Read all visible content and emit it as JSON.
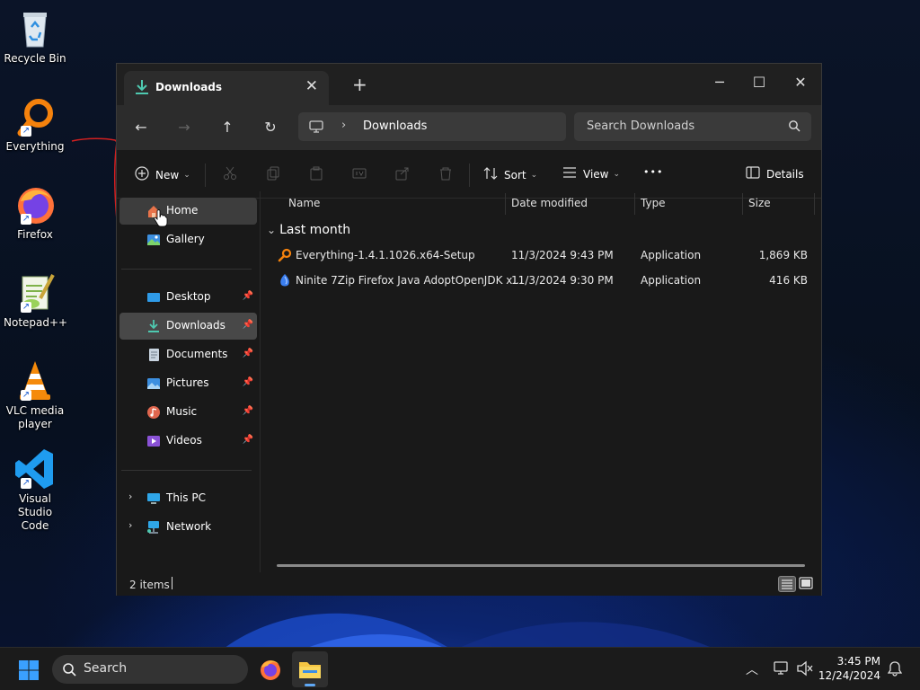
{
  "desktop": {
    "icons": [
      {
        "label": "Recycle Bin",
        "icon": "recycle-bin-icon"
      },
      {
        "label": "Everything",
        "icon": "everything-search-icon"
      },
      {
        "label": "Firefox",
        "icon": "firefox-icon"
      },
      {
        "label": "Notepad++",
        "icon": "notepad-plus-plus-icon"
      },
      {
        "label": "VLC media player",
        "icon": "vlc-icon"
      },
      {
        "label": "Visual Studio Code",
        "icon": "vscode-icon"
      }
    ]
  },
  "window": {
    "tab_title": "Downloads",
    "tab_close": "✕",
    "new_tab": "+",
    "controls": {
      "minimize": "─",
      "maximize": "☐",
      "close": "✕"
    },
    "nav": {
      "back": "←",
      "forward": "→",
      "up": "↑",
      "refresh": "↻"
    },
    "address": {
      "separator": "›",
      "crumb": "Downloads"
    },
    "search_placeholder": "Search Downloads",
    "commands": {
      "new": "New",
      "sort": "Sort",
      "view": "View",
      "more": "•••",
      "details": "Details"
    },
    "sidebar": {
      "home": "Home",
      "gallery": "Gallery",
      "quick_access": [
        {
          "label": "Desktop",
          "icon": "desktop-icon"
        },
        {
          "label": "Downloads",
          "icon": "download-icon"
        },
        {
          "label": "Documents",
          "icon": "documents-icon"
        },
        {
          "label": "Pictures",
          "icon": "pictures-icon"
        },
        {
          "label": "Music",
          "icon": "music-icon"
        },
        {
          "label": "Videos",
          "icon": "videos-icon"
        }
      ],
      "this_pc": "This PC",
      "network": "Network",
      "expander": "›"
    },
    "columns": {
      "name": "Name",
      "date": "Date modified",
      "type": "Type",
      "size": "Size"
    },
    "group": {
      "chevron": "⌄",
      "label": "Last month"
    },
    "files": [
      {
        "name": "Everything-1.4.1.1026.x64-Setup",
        "date": "11/3/2024 9:43 PM",
        "type": "Application",
        "size": "1,869 KB",
        "icon": "everything-search-icon"
      },
      {
        "name": "Ninite 7Zip Firefox Java AdoptOpenJDK x...",
        "date": "11/3/2024 9:30 PM",
        "type": "Application",
        "size": "416 KB",
        "icon": "ninite-icon"
      }
    ],
    "status": {
      "count": "2 items"
    }
  },
  "taskbar": {
    "search": "Search",
    "time": "3:45 PM",
    "date": "12/24/2024"
  },
  "colors": {
    "accent": "#5fa8f5",
    "download_green": "#4ec9b0",
    "window_bg": "#191919"
  }
}
